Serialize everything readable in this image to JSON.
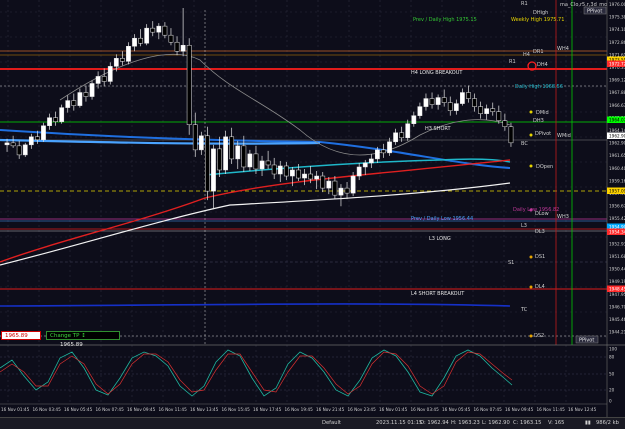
{
  "instrument": {
    "label": "ma_Clo,r5,r,3d_mod (J"
  },
  "top_buttons": {
    "pivot": "PPivot"
  },
  "levels": [
    {
      "name": "R1",
      "label": "R1"
    },
    {
      "name": "DHigh",
      "label": "DHigh"
    },
    {
      "name": "prev_daily_high",
      "label": "Prev / Daily High 1975.15"
    },
    {
      "name": "weekly_high",
      "label": "Weekly High 1975.71"
    },
    {
      "name": "DR1",
      "label": "DR1"
    },
    {
      "name": "WH4",
      "label": "WH4"
    },
    {
      "name": "H4",
      "label": "H4"
    },
    {
      "name": "DH4",
      "label": "DH4"
    },
    {
      "name": "R1b",
      "label": "R1"
    },
    {
      "name": "h4_long_breakout",
      "label": "H4 LONG BREAKOUT"
    },
    {
      "name": "daily_high",
      "label": "Daily High 1968.56"
    },
    {
      "name": "DMid",
      "label": "DMid"
    },
    {
      "name": "DH3",
      "label": "DH3"
    },
    {
      "name": "h3_short",
      "label": "H3 SHORT"
    },
    {
      "name": "DPivot",
      "label": "DPivot"
    },
    {
      "name": "WMid",
      "label": "WMid"
    },
    {
      "name": "BC",
      "label": "BC"
    },
    {
      "name": "DOpen",
      "label": "DOpen"
    },
    {
      "name": "daily_low",
      "label": "Daily Low 1956.82"
    },
    {
      "name": "DLow",
      "label": "DLow"
    },
    {
      "name": "prev_daily_low",
      "label": "Prev / Daily Low 1956.44"
    },
    {
      "name": "WH3",
      "label": "WH3"
    },
    {
      "name": "L3",
      "label": "L3"
    },
    {
      "name": "DL3",
      "label": "DL3"
    },
    {
      "name": "l3_long",
      "label": "L3 LONG"
    },
    {
      "name": "DS1",
      "label": "DS1"
    },
    {
      "name": "S1",
      "label": "S1"
    },
    {
      "name": "DL4",
      "label": "DL4"
    },
    {
      "name": "l4_short_breakout",
      "label": "L4 SHORT BREAKOUT"
    },
    {
      "name": "TC",
      "label": "TC"
    },
    {
      "name": "DS2",
      "label": "DS2"
    },
    {
      "name": "PPivot_bottom",
      "label": "PPivot"
    }
  ],
  "price_axis": [
    "1976.00",
    "1975.38",
    "1974.10",
    "1972.86",
    "1971.61",
    "1970.37",
    "1969.12",
    "1967.88",
    "1966.63",
    "1965.38",
    "1964.14",
    "1962.90",
    "1961.65",
    "1960.40",
    "1959.16",
    "1957.91",
    "1956.67",
    "1955.42",
    "1954.18",
    "1952.93",
    "1951.68",
    "1950.44",
    "1949.19",
    "1947.95",
    "1946.70",
    "1945.46",
    "1944.21"
  ],
  "price_markers": [
    {
      "label": "1973.55",
      "color": "#ffd400"
    },
    {
      "label": "1972.72",
      "color": "#ff2b2b"
    },
    {
      "label": "1964.07",
      "color": "#00ff00"
    },
    {
      "label": "1962.90",
      "color": "#ffffff"
    },
    {
      "label": "1957.09",
      "color": "#ffd400"
    },
    {
      "label": "1954.90",
      "color": "#00aaff"
    },
    {
      "label": "1954.34",
      "color": "#ff2b2b"
    },
    {
      "label": "1948.45",
      "color": "#ff2b2b"
    }
  ],
  "osc_axis": [
    "100",
    "80",
    "50",
    "20",
    "0"
  ],
  "time_axis": [
    "16 Nov 01:45",
    "16 Nov 03:45",
    "16 Nov 05:45",
    "16 Nov 07:45",
    "16 Nov 09:45",
    "16 Nov 11:45",
    "16 Nov 13:45",
    "16 Nov 15:45",
    "16 Nov 17:45",
    "16 Nov 19:45",
    "16 Nov 21:45",
    "16 Nov 23:45",
    "16 Nov 01:45",
    "16 Nov 03:45",
    "16 Nov 05:45",
    "16 Nov 07:45",
    "16 Nov 09:45",
    "16 Nov 11:45",
    "16 Nov 12:45"
  ],
  "boxes": {
    "price_box": "1965.89",
    "tp_label": "Change TP",
    "tp_value": "1965.89"
  },
  "status": {
    "profile": "Default",
    "datetime": "2023.11.15 01:15",
    "open": "O: 1962.94",
    "high": "H: 1963.23",
    "low": "L: 1962.90",
    "close": "C: 1963.15",
    "volume": "V: 165",
    "traffic": "986/2 kb"
  },
  "colors": {
    "bg": "#0d0d1a",
    "bull": "#ffffff",
    "bear": "#000000",
    "ma_red": "#e02020",
    "ma_white": "#f2f2f2",
    "ma_cyan": "#1fb7c9",
    "ma_blue": "#1f6fe0"
  },
  "chart_data": {
    "type": "candlestick",
    "ylim": [
      1943.6,
      1977.0
    ],
    "candles": [
      [
        1963.0,
        1963.6,
        1962.3,
        1963.2
      ],
      [
        1963.2,
        1963.9,
        1962.7,
        1962.9
      ],
      [
        1962.9,
        1963.4,
        1961.6,
        1962.0
      ],
      [
        1962.0,
        1963.2,
        1961.8,
        1963.0
      ],
      [
        1963.0,
        1964.1,
        1962.6,
        1963.8
      ],
      [
        1963.8,
        1964.4,
        1963.1,
        1963.5
      ],
      [
        1963.5,
        1965.2,
        1963.3,
        1964.9
      ],
      [
        1964.9,
        1966.1,
        1964.5,
        1965.7
      ],
      [
        1965.7,
        1966.3,
        1964.9,
        1965.3
      ],
      [
        1965.3,
        1967.0,
        1965.1,
        1966.7
      ],
      [
        1966.7,
        1967.9,
        1966.2,
        1967.4
      ],
      [
        1967.4,
        1968.1,
        1966.4,
        1966.9
      ],
      [
        1966.9,
        1968.6,
        1966.7,
        1968.2
      ],
      [
        1968.2,
        1968.9,
        1967.3,
        1967.8
      ],
      [
        1967.8,
        1969.4,
        1967.5,
        1969.1
      ],
      [
        1969.1,
        1970.3,
        1968.6,
        1969.8
      ],
      [
        1969.8,
        1970.6,
        1968.8,
        1969.3
      ],
      [
        1969.3,
        1971.2,
        1969.0,
        1970.8
      ],
      [
        1970.8,
        1972.0,
        1970.3,
        1971.6
      ],
      [
        1971.6,
        1972.3,
        1970.9,
        1971.3
      ],
      [
        1971.3,
        1973.2,
        1971.0,
        1972.8
      ],
      [
        1972.8,
        1974.0,
        1972.3,
        1973.6
      ],
      [
        1973.6,
        1974.5,
        1972.8,
        1973.1
      ],
      [
        1973.1,
        1975.0,
        1972.9,
        1974.6
      ],
      [
        1974.6,
        1975.3,
        1973.8,
        1974.2
      ],
      [
        1974.2,
        1975.1,
        1973.5,
        1974.8
      ],
      [
        1974.8,
        1975.2,
        1973.6,
        1973.9
      ],
      [
        1973.9,
        1974.6,
        1972.9,
        1973.2
      ],
      [
        1973.2,
        1973.8,
        1971.9,
        1972.3
      ],
      [
        1972.3,
        1976.6,
        1971.8,
        1972.9
      ],
      [
        1972.9,
        1973.6,
        1964.0,
        1965.0
      ],
      [
        1965.0,
        1966.2,
        1961.8,
        1962.5
      ],
      [
        1962.5,
        1964.3,
        1962.0,
        1963.9
      ],
      [
        1963.9,
        1964.8,
        1957.5,
        1958.4
      ],
      [
        1958.4,
        1963.0,
        1956.6,
        1962.6
      ],
      [
        1962.6,
        1963.8,
        1959.8,
        1960.5
      ],
      [
        1960.5,
        1964.4,
        1960.1,
        1963.8
      ],
      [
        1963.8,
        1964.7,
        1961.1,
        1961.6
      ],
      [
        1961.6,
        1963.4,
        1960.6,
        1962.9
      ],
      [
        1962.9,
        1963.9,
        1960.3,
        1960.8
      ],
      [
        1960.8,
        1962.5,
        1960.4,
        1962.1
      ],
      [
        1962.1,
        1962.9,
        1960.1,
        1960.6
      ],
      [
        1960.6,
        1961.9,
        1959.9,
        1961.4
      ],
      [
        1961.4,
        1962.4,
        1960.6,
        1961.0
      ],
      [
        1961.0,
        1961.7,
        1959.6,
        1960.1
      ],
      [
        1960.1,
        1961.4,
        1959.3,
        1960.9
      ],
      [
        1960.9,
        1961.3,
        1959.5,
        1959.9
      ],
      [
        1959.9,
        1960.8,
        1958.9,
        1960.5
      ],
      [
        1960.5,
        1961.1,
        1959.4,
        1959.7
      ],
      [
        1959.7,
        1960.6,
        1959.0,
        1960.1
      ],
      [
        1960.1,
        1960.9,
        1959.2,
        1959.6
      ],
      [
        1959.6,
        1960.4,
        1958.6,
        1959.9
      ],
      [
        1959.9,
        1960.3,
        1958.3,
        1958.7
      ],
      [
        1958.7,
        1959.8,
        1958.1,
        1959.4
      ],
      [
        1959.4,
        1959.9,
        1957.6,
        1958.0
      ],
      [
        1958.0,
        1959.1,
        1956.9,
        1958.7
      ],
      [
        1958.7,
        1959.3,
        1957.6,
        1958.2
      ],
      [
        1958.2,
        1960.3,
        1957.9,
        1959.9
      ],
      [
        1959.9,
        1961.2,
        1959.5,
        1960.8
      ],
      [
        1960.8,
        1961.5,
        1960.0,
        1961.2
      ],
      [
        1961.2,
        1962.1,
        1960.7,
        1961.6
      ],
      [
        1961.6,
        1962.8,
        1961.2,
        1962.5
      ],
      [
        1962.5,
        1963.1,
        1961.7,
        1962.2
      ],
      [
        1962.2,
        1963.7,
        1961.9,
        1963.3
      ],
      [
        1963.3,
        1964.6,
        1963.0,
        1964.2
      ],
      [
        1964.2,
        1964.8,
        1963.3,
        1963.7
      ],
      [
        1963.7,
        1965.5,
        1963.4,
        1965.1
      ],
      [
        1965.1,
        1966.3,
        1964.8,
        1965.9
      ],
      [
        1965.9,
        1967.2,
        1965.6,
        1966.8
      ],
      [
        1966.8,
        1968.1,
        1966.4,
        1967.6
      ],
      [
        1967.6,
        1968.2,
        1966.6,
        1967.0
      ],
      [
        1967.0,
        1968.0,
        1966.5,
        1967.7
      ],
      [
        1967.7,
        1968.5,
        1966.8,
        1967.2
      ],
      [
        1967.2,
        1967.8,
        1965.9,
        1966.4
      ],
      [
        1966.4,
        1967.5,
        1966.0,
        1967.1
      ],
      [
        1967.1,
        1968.6,
        1966.9,
        1968.2
      ],
      [
        1968.2,
        1968.9,
        1967.2,
        1967.6
      ],
      [
        1967.6,
        1968.1,
        1966.3,
        1966.8
      ],
      [
        1966.8,
        1967.3,
        1965.6,
        1966.1
      ],
      [
        1966.1,
        1967.0,
        1965.5,
        1966.6
      ],
      [
        1966.6,
        1967.2,
        1965.9,
        1966.3
      ],
      [
        1966.3,
        1966.9,
        1965.1,
        1965.4
      ],
      [
        1965.4,
        1966.1,
        1964.4,
        1964.8
      ],
      [
        1964.8,
        1965.2,
        1962.8,
        1963.2
      ]
    ]
  }
}
